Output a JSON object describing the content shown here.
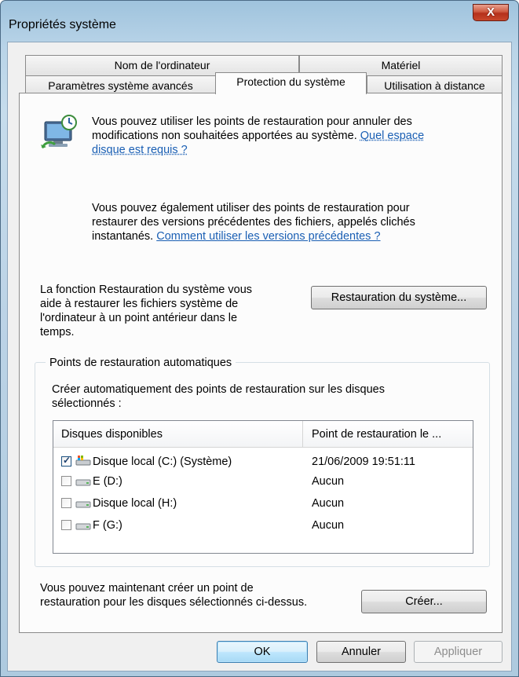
{
  "window": {
    "title": "Propriétés système",
    "close_glyph": "X"
  },
  "tabs": {
    "top_row": [
      "Nom de l'ordinateur",
      "Matériel"
    ],
    "bottom_row": [
      "Paramètres système avancés",
      "Protection du système",
      "Utilisation à distance"
    ],
    "active": "Protection du système"
  },
  "intro": {
    "icon": "system-restore-icon",
    "p1_lines": [
      "Vous pouvez utiliser les points de restauration pour annuler des",
      "modifications non souhaitées apportées au système. "
    ],
    "p1_link_a": "Quel espace",
    "p1_link_b": "disque est requis ?",
    "p2_lines": [
      "Vous pouvez également utiliser des points de restauration pour",
      "restaurer des versions précédentes des fichiers, appelés clichés",
      "instantanés. "
    ],
    "p2_link": "Comment utiliser les versions précédentes ?"
  },
  "restore": {
    "description_lines": [
      "La fonction Restauration du système vous",
      "aide à restaurer les fichiers système de",
      "l'ordinateur à un point antérieur dans le",
      "temps."
    ],
    "button": "Restauration du système..."
  },
  "auto_points": {
    "group_title": "Points de restauration automatiques",
    "description_lines": [
      "Créer automatiquement des points de restauration sur les disques",
      "sélectionnés :"
    ],
    "columns": [
      "Disques disponibles",
      "Point de restauration le ..."
    ],
    "disks": [
      {
        "name": "Disque local (C:) (Système)",
        "checked": true,
        "icon": "system-drive-icon",
        "restore_point": "21/06/2009 19:51:11"
      },
      {
        "name": "E (D:)",
        "checked": false,
        "icon": "drive-icon",
        "restore_point": "Aucun"
      },
      {
        "name": "Disque local (H:)",
        "checked": false,
        "icon": "drive-icon",
        "restore_point": "Aucun"
      },
      {
        "name": "F (G:)",
        "checked": false,
        "icon": "drive-icon",
        "restore_point": "Aucun"
      }
    ]
  },
  "create": {
    "description_lines": [
      "Vous pouvez maintenant créer un point de",
      "restauration pour les disques sélectionnés ci-dessus."
    ],
    "button": "Créer..."
  },
  "footer": {
    "ok": "OK",
    "cancel": "Annuler",
    "apply": "Appliquer"
  }
}
